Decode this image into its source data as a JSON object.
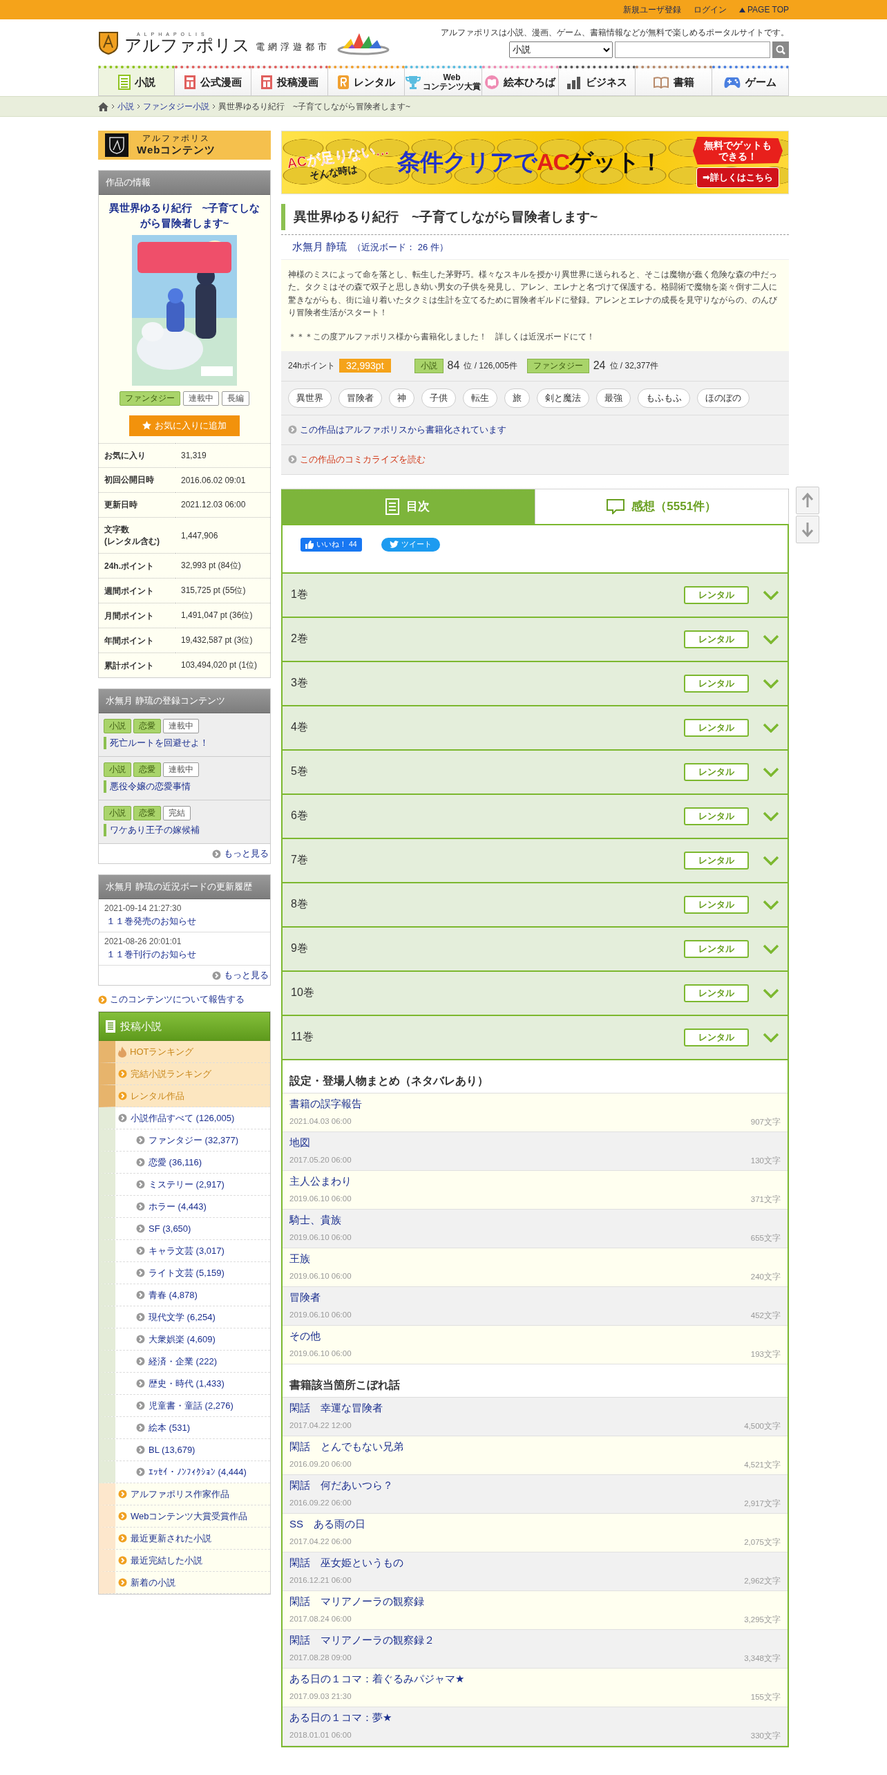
{
  "top_bar": {
    "links": [
      "新規ユーザ登録",
      "ログイン",
      "PAGE TOP"
    ]
  },
  "header": {
    "logo_sub": "ALPHAPOLIS",
    "logo_name": "アルファポリス",
    "logo_tagline": "電網浮遊都市",
    "tagline": "アルファポリスは小説、漫画、ゲーム、書籍情報などが無料で楽しめるポータルサイトです。",
    "search": {
      "category": "小説"
    }
  },
  "nav": [
    {
      "label": "小説",
      "kind": "novel",
      "selected": true
    },
    {
      "label": "公式漫画",
      "kind": "manga",
      "selected": false
    },
    {
      "label": "投稿漫画",
      "kind": "usermanga",
      "selected": false
    },
    {
      "label": "レンタル",
      "kind": "rental",
      "selected": false
    },
    {
      "label": "Web\nコンテンツ大賞",
      "kind": "award",
      "selected": false
    },
    {
      "label": "絵本ひろば",
      "kind": "picturebook",
      "selected": false
    },
    {
      "label": "ビジネス",
      "kind": "business",
      "selected": false
    },
    {
      "label": "書籍",
      "kind": "books",
      "selected": false
    },
    {
      "label": "ゲーム",
      "kind": "game",
      "selected": false
    }
  ],
  "breadcrumb": [
    {
      "label": "小説",
      "kind": "link"
    },
    {
      "label": "ファンタジー小説",
      "kind": "link"
    },
    {
      "label": "異世界ゆるり紀行　~子育てしながら冒険者します~",
      "kind": "current"
    }
  ],
  "sidebar": {
    "banner": {
      "line1": "アルファポリス",
      "line2": "Webコンテンツ"
    },
    "info": {
      "heading": "作品の情報",
      "title": "異世界ゆるり紀行　~子育てしながら冒険者します~",
      "tags": [
        {
          "label": "ファンタジー",
          "kind": "genre"
        },
        {
          "label": "連載中",
          "kind": "status"
        },
        {
          "label": "長編",
          "kind": "status"
        }
      ],
      "favorite_button": "お気に入りに追加",
      "stats": [
        {
          "label": "お気に入り",
          "value": "31,319"
        },
        {
          "label": "初回公開日時",
          "value": "2016.06.02 09:01"
        },
        {
          "label": "更新日時",
          "value": "2021.12.03 06:00"
        },
        {
          "label": "文字数\n(レンタル含む)",
          "value": "1,447,906"
        },
        {
          "label": "24h.ポイント",
          "value": "32,993 pt (84位)"
        },
        {
          "label": "週間ポイント",
          "value": "315,725 pt (55位)"
        },
        {
          "label": "月間ポイント",
          "value": "1,491,047 pt (36位)"
        },
        {
          "label": "年間ポイント",
          "value": "19,432,587 pt (3位)"
        },
        {
          "label": "累計ポイント",
          "value": "103,494,020 pt (1位)"
        }
      ]
    },
    "author_works": {
      "heading": "水無月 静琉の登録コンテンツ",
      "works": [
        {
          "tags": [
            {
              "label": "小説",
              "kind": "genre"
            },
            {
              "label": "恋愛",
              "kind": "genre"
            },
            {
              "label": "連載中",
              "kind": "status"
            }
          ],
          "title": "死亡ルートを回避せよ！"
        },
        {
          "tags": [
            {
              "label": "小説",
              "kind": "genre"
            },
            {
              "label": "恋愛",
              "kind": "genre"
            },
            {
              "label": "連載中",
              "kind": "status"
            }
          ],
          "title": "悪役令嬢の恋愛事情"
        },
        {
          "tags": [
            {
              "label": "小説",
              "kind": "genre"
            },
            {
              "label": "恋愛",
              "kind": "genre"
            },
            {
              "label": "完結",
              "kind": "status"
            }
          ],
          "title": "ワケあり王子の嫁候補"
        }
      ],
      "more": "もっと見る"
    },
    "board_history": {
      "heading": "水無月 静琉の近況ボードの更新履歴",
      "posts": [
        {
          "date": "2021-09-14 21:27:30",
          "title": "１１巻発売のお知らせ"
        },
        {
          "date": "2021-08-26 20:01:01",
          "title": "１１巻刊行のお知らせ"
        }
      ],
      "more": "もっと見る"
    },
    "report_link": "このコンテンツについて報告する",
    "menu": {
      "heading": "投稿小説",
      "items": [
        {
          "label": "HOTランキング",
          "kind": "hot"
        },
        {
          "label": "完結小説ランキング",
          "kind": "featured"
        },
        {
          "label": "レンタル作品",
          "kind": "featured"
        },
        {
          "label": "小説作品すべて (126,005)",
          "kind": "all",
          "children": [
            {
              "label": "ファンタジー (32,377)"
            },
            {
              "label": "恋愛 (36,116)"
            },
            {
              "label": "ミステリー (2,917)"
            },
            {
              "label": "ホラー (4,443)"
            },
            {
              "label": "SF (3,650)"
            },
            {
              "label": "キャラ文芸 (3,017)"
            },
            {
              "label": "ライト文芸 (5,159)"
            },
            {
              "label": "青春 (4,878)"
            },
            {
              "label": "現代文学 (6,254)"
            },
            {
              "label": "大衆娯楽 (4,609)"
            },
            {
              "label": "経済・企業 (222)"
            },
            {
              "label": "歴史・時代 (1,433)"
            },
            {
              "label": "児童書・童話 (2,276)"
            },
            {
              "label": "絵本 (531)"
            },
            {
              "label": "BL (13,679)"
            },
            {
              "label": "ｴｯｾｲ・ﾉﾝﾌｨｸｼｮﾝ (4,444)"
            }
          ]
        },
        {
          "label": "アルファポリス作家作品",
          "kind": "extra"
        },
        {
          "label": "Webコンテンツ大賞受賞作品",
          "kind": "extra"
        },
        {
          "label": "最近更新された小説",
          "kind": "extra"
        },
        {
          "label": "最近完結した小説",
          "kind": "extra"
        },
        {
          "label": "新着の小説",
          "kind": "extra"
        }
      ]
    }
  },
  "main": {
    "banner": {
      "lead": "ACが足りない…",
      "lead2": "そんな時は",
      "headline": [
        "条件クリアで",
        "AC",
        "ゲット！"
      ],
      "badge": "無料でゲットもできる！",
      "button": "➡詳しくはこちら"
    },
    "work": {
      "title": "異世界ゆるり紀行　~子育てしながら冒険者します~",
      "author": "水無月 静琉",
      "board_count": "（近況ボード： 26 件）",
      "synopsis": [
        "神様のミスによって命を落とし、転生した茅野巧。様々なスキルを授かり異世界に送られると、そこは魔物が蠢く危険な森の中だった。タクミはその森で双子と思しき幼い男女の子供を発見し、アレン、エレナと名づけて保護する。格闘術で魔物を楽々倒す二人に驚きながらも、街に辿り着いたタクミは生計を立てるために冒険者ギルドに登録。アレンとエレナの成長を見守りながらの、のんびり冒険者生活がスタート！",
        "＊＊＊この度アルファポリス様から書籍化しました！　詳しくは近況ボードにて！"
      ],
      "points": {
        "label": "24hポイント",
        "value": "32,993pt",
        "rankings": [
          {
            "tag": "小説",
            "rank": "84",
            "total": "位 / 126,005件"
          },
          {
            "tag": "ファンタジー",
            "rank": "24",
            "total": "位 / 32,377件"
          }
        ]
      },
      "tags": [
        "異世界",
        "冒険者",
        "神",
        "子供",
        "転生",
        "旅",
        "剣と魔法",
        "最強",
        "もふもふ",
        "ほのぼの"
      ],
      "links": [
        {
          "text": "この作品はアルファポリスから書籍化されています",
          "kind": "info"
        },
        {
          "text": "この作品のコミカライズを読む",
          "kind": "comic"
        }
      ]
    },
    "toc": {
      "tabs": [
        {
          "label": "目次",
          "kind": "toc",
          "selected": true
        },
        {
          "label": "感想（5551件）",
          "kind": "comments",
          "selected": false
        }
      ],
      "social": {
        "like": "いいね！ 44",
        "tweet": "ツイート"
      },
      "volumes": [
        {
          "title": "1巻",
          "button": "レンタル"
        },
        {
          "title": "2巻",
          "button": "レンタル"
        },
        {
          "title": "3巻",
          "button": "レンタル"
        },
        {
          "title": "4巻",
          "button": "レンタル"
        },
        {
          "title": "5巻",
          "button": "レンタル"
        },
        {
          "title": "6巻",
          "button": "レンタル"
        },
        {
          "title": "7巻",
          "button": "レンタル"
        },
        {
          "title": "8巻",
          "button": "レンタル"
        },
        {
          "title": "9巻",
          "button": "レンタル"
        },
        {
          "title": "10巻",
          "button": "レンタル"
        },
        {
          "title": "11巻",
          "button": "レンタル"
        }
      ],
      "sections": [
        {
          "heading": "設定・登場人物まとめ（ネタバレあり）",
          "episodes": [
            {
              "title": "書籍の誤字報告",
              "date": "2021.04.03 06:00",
              "chars": "907文字"
            },
            {
              "title": "地図",
              "date": "2017.05.20 06:00",
              "chars": "130文字"
            },
            {
              "title": "主人公まわり",
              "date": "2019.06.10 06:00",
              "chars": "371文字"
            },
            {
              "title": "騎士、貴族",
              "date": "2019.06.10 06:00",
              "chars": "655文字"
            },
            {
              "title": "王族",
              "date": "2019.06.10 06:00",
              "chars": "240文字"
            },
            {
              "title": "冒険者",
              "date": "2019.06.10 06:00",
              "chars": "452文字"
            },
            {
              "title": "その他",
              "date": "2019.06.10 06:00",
              "chars": "193文字"
            }
          ]
        },
        {
          "heading": "書籍該当箇所こぼれ話",
          "episodes": [
            {
              "title": "閑話　幸運な冒険者",
              "date": "2017.04.22 12:00",
              "chars": "4,500文字"
            },
            {
              "title": "閑話　とんでもない兄弟",
              "date": "2016.09.20 06:00",
              "chars": "4,521文字"
            },
            {
              "title": "閑話　何だあいつら？",
              "date": "2016.09.22 06:00",
              "chars": "2,917文字"
            },
            {
              "title": "SS　ある雨の日",
              "date": "2017.04.22 06:00",
              "chars": "2,075文字"
            },
            {
              "title": "閑話　巫女姫というもの",
              "date": "2016.12.21 06:00",
              "chars": "2,962文字"
            },
            {
              "title": "閑話　マリアノーラの観察録",
              "date": "2017.08.24 06:00",
              "chars": "3,295文字"
            },
            {
              "title": "閑話　マリアノーラの観察録２",
              "date": "2017.08.28 09:00",
              "chars": "3,348文字"
            },
            {
              "title": "ある日の１コマ：着ぐるみパジャマ★",
              "date": "2017.09.03 21:30",
              "chars": "155文字"
            },
            {
              "title": "ある日の１コマ：夢★",
              "date": "2018.01.01 06:00",
              "chars": "330文字"
            }
          ]
        }
      ]
    }
  }
}
